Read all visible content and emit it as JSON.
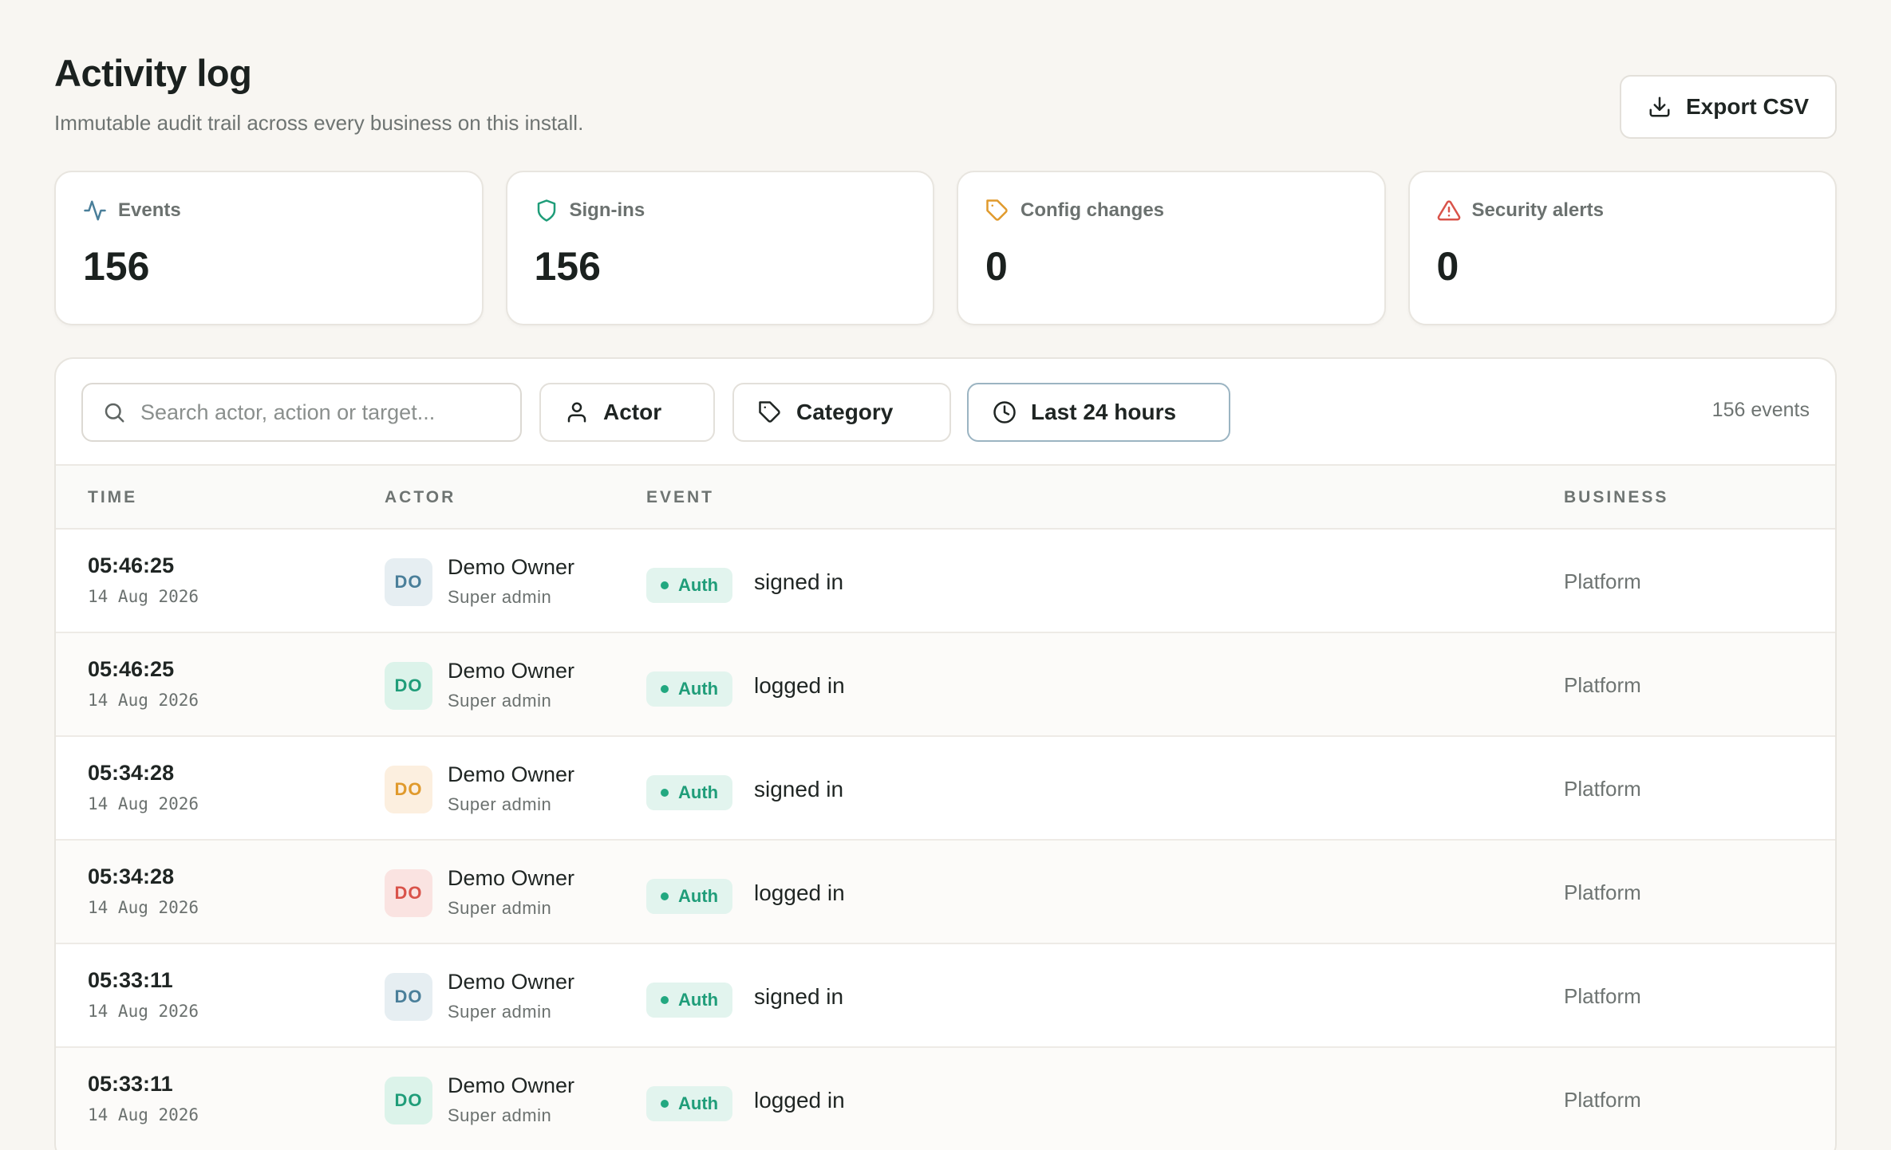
{
  "header": {
    "title": "Activity log",
    "subtitle": "Immutable audit trail across every business on this install.",
    "export_label": "Export CSV"
  },
  "stats": [
    {
      "label": "Events",
      "value": "156",
      "icon": "activity-icon",
      "color": "#4a7f9a"
    },
    {
      "label": "Sign-ins",
      "value": "156",
      "icon": "shield-icon",
      "color": "#1f9d79"
    },
    {
      "label": "Config changes",
      "value": "0",
      "icon": "tag-icon",
      "color": "#e09a2c"
    },
    {
      "label": "Security alerts",
      "value": "0",
      "icon": "alert-triangle-icon",
      "color": "#d9534a"
    }
  ],
  "toolbar": {
    "search_placeholder": "Search actor, action or target...",
    "actor_label": "Actor",
    "category_label": "Category",
    "range_label": "Last 24 hours",
    "count_label": "156 events"
  },
  "table": {
    "headers": {
      "time": "TIME",
      "actor": "ACTOR",
      "event": "EVENT",
      "business": "BUSINESS"
    },
    "rows": [
      {
        "time": "05:46:25",
        "date": "14 Aug 2026",
        "initials": "DO",
        "avatar_bg": "#e6eef2",
        "avatar_fg": "#4a7f9a",
        "name": "Demo Owner",
        "role": "Super admin",
        "category": "Auth",
        "event": "signed in",
        "business": "Platform"
      },
      {
        "time": "05:46:25",
        "date": "14 Aug 2026",
        "initials": "DO",
        "avatar_bg": "#dcf3ea",
        "avatar_fg": "#1f9d79",
        "name": "Demo Owner",
        "role": "Super admin",
        "category": "Auth",
        "event": "logged in",
        "business": "Platform"
      },
      {
        "time": "05:34:28",
        "date": "14 Aug 2026",
        "initials": "DO",
        "avatar_bg": "#fcefdf",
        "avatar_fg": "#e09a2c",
        "name": "Demo Owner",
        "role": "Super admin",
        "category": "Auth",
        "event": "signed in",
        "business": "Platform"
      },
      {
        "time": "05:34:28",
        "date": "14 Aug 2026",
        "initials": "DO",
        "avatar_bg": "#fae3e1",
        "avatar_fg": "#d9534a",
        "name": "Demo Owner",
        "role": "Super admin",
        "category": "Auth",
        "event": "logged in",
        "business": "Platform"
      },
      {
        "time": "05:33:11",
        "date": "14 Aug 2026",
        "initials": "DO",
        "avatar_bg": "#e6eef2",
        "avatar_fg": "#4a7f9a",
        "name": "Demo Owner",
        "role": "Super admin",
        "category": "Auth",
        "event": "signed in",
        "business": "Platform"
      },
      {
        "time": "05:33:11",
        "date": "14 Aug 2026",
        "initials": "DO",
        "avatar_bg": "#dcf3ea",
        "avatar_fg": "#1f9d79",
        "name": "Demo Owner",
        "role": "Super admin",
        "category": "Auth",
        "event": "logged in",
        "business": "Platform"
      }
    ]
  }
}
